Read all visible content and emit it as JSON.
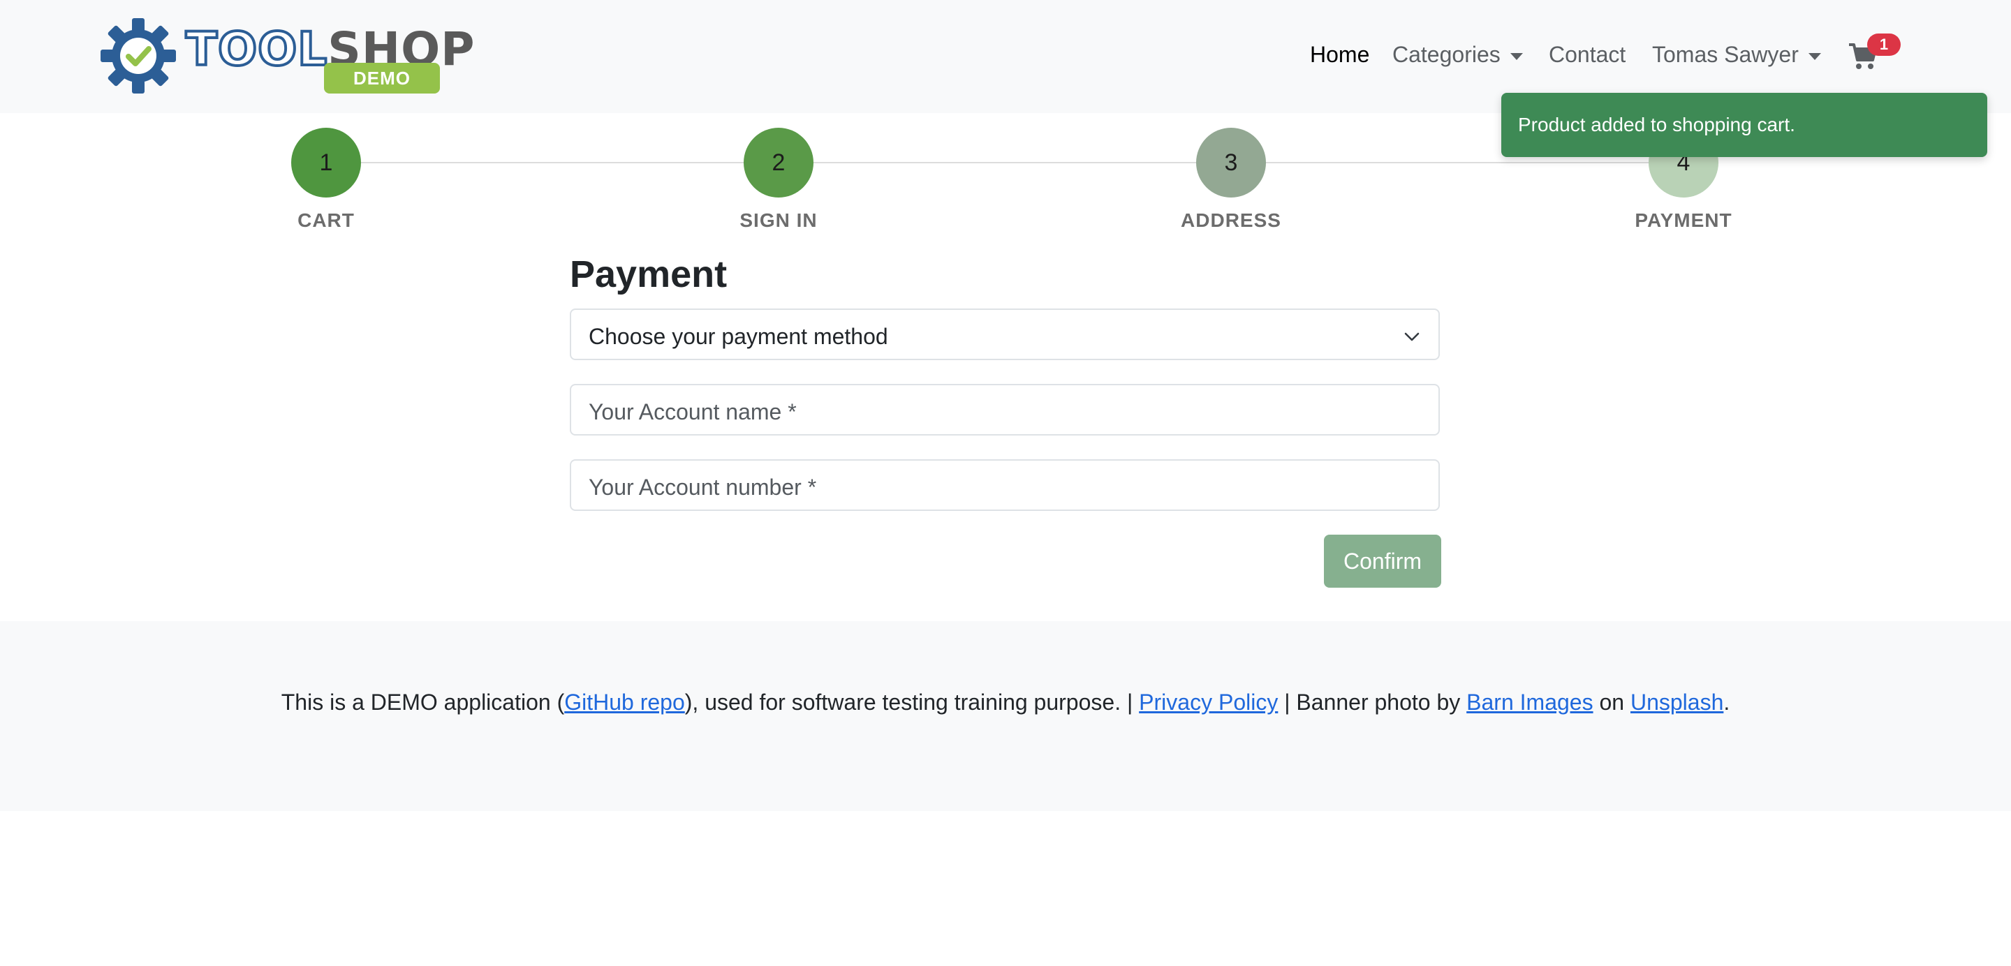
{
  "brand": {
    "word_tool": "TOOL",
    "word_shop": "SHOP",
    "badge": "DEMO"
  },
  "nav": {
    "home": "Home",
    "categories": "Categories",
    "contact": "Contact",
    "user": "Tomas Sawyer",
    "cart_count": "1"
  },
  "toast": {
    "message": "Product added to shopping cart."
  },
  "steps": [
    {
      "number": "1",
      "label": "CART",
      "color": "#4f963f"
    },
    {
      "number": "2",
      "label": "SIGN IN",
      "color": "#5a9a48"
    },
    {
      "number": "3",
      "label": "ADDRESS",
      "color": "#93a893"
    },
    {
      "number": "4",
      "label": "PAYMENT",
      "color": "#b9d2b6"
    }
  ],
  "payment": {
    "title": "Payment",
    "method_select": "Choose your payment method",
    "account_name_placeholder": "Your Account name *",
    "account_number_placeholder": "Your Account number *",
    "confirm": "Confirm"
  },
  "footer": {
    "text_1": "This is a DEMO application (",
    "github_link": "GitHub repo",
    "text_2": "), used for software testing training purpose. | ",
    "privacy_link": "Privacy Policy",
    "text_3": " | Banner photo by ",
    "barn_link": "Barn Images",
    "text_4": " on ",
    "unsplash_link": "Unsplash",
    "text_5": "."
  }
}
